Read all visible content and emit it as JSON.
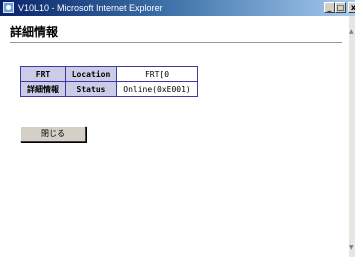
{
  "window": {
    "title": "V10L10 - Microsoft Internet Explorer",
    "minimize_glyph": "_",
    "maximize_glyph": "□",
    "close_glyph": "x"
  },
  "page": {
    "heading": "詳細情報"
  },
  "table": {
    "row_header_top": "FRT",
    "row_header_bottom": "詳細情報",
    "rows": [
      {
        "key": "Location",
        "value": "FRT[0"
      },
      {
        "key": "Status",
        "value": "Online(0xE001)"
      }
    ]
  },
  "actions": {
    "close_label": "閉じる"
  },
  "icons": [
    "ie-app-icon",
    "minimize-icon",
    "maximize-icon",
    "close-icon"
  ]
}
